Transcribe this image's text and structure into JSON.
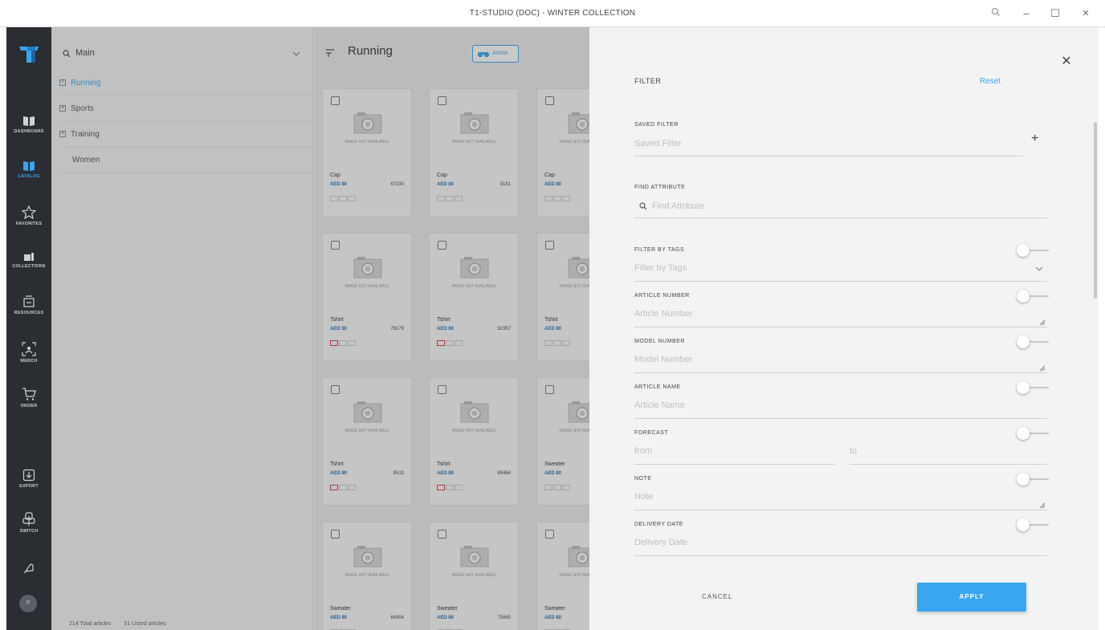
{
  "window": {
    "title": "T1-STUDIO (DOC) - WINTER COLLECTION"
  },
  "nav": [
    {
      "label": "DASHBOARD",
      "icon": "dashboard-icon"
    },
    {
      "label": "CATALOG",
      "icon": "catalog-icon"
    },
    {
      "label": "FAVORITES",
      "icon": "star-icon"
    },
    {
      "label": "COLLECTIONS",
      "icon": "collections-icon"
    },
    {
      "label": "RESOURCES",
      "icon": "resources-icon"
    },
    {
      "label": "MERCH",
      "icon": "merch-icon"
    },
    {
      "label": "ORDER",
      "icon": "cart-icon"
    },
    {
      "label": "EXPORT",
      "icon": "export-icon"
    },
    {
      "label": "SWITCH",
      "icon": "switch-icon"
    }
  ],
  "user": {
    "initials": "IT"
  },
  "tree": {
    "search_value": "Main",
    "items": [
      "Running",
      "Sports",
      "Training",
      "Women"
    ],
    "status": [
      "214 Total articles",
      "51 Listed articles"
    ]
  },
  "main": {
    "title": "Running",
    "article_button": "Article",
    "image_placeholder": "IMAGE NOT AVAILABLE",
    "price": "AED 80",
    "cards": [
      {
        "name": "Cap",
        "sku": "67330"
      },
      {
        "name": "Cap",
        "sku": "9181"
      },
      {
        "name": "Cap",
        "sku": ""
      },
      {
        "name": "Tshirt",
        "sku": "79179"
      },
      {
        "name": "Tshirt",
        "sku": "92357"
      },
      {
        "name": "Tshirt",
        "sku": ""
      },
      {
        "name": "Tshirt",
        "sku": "8519"
      },
      {
        "name": "Tshirt",
        "sku": "88464"
      },
      {
        "name": "Sweater",
        "sku": ""
      },
      {
        "name": "Sweater",
        "sku": "64904"
      },
      {
        "name": "Sweater",
        "sku": "75865"
      },
      {
        "name": "Sweater",
        "sku": ""
      }
    ]
  },
  "filter": {
    "title": "FILTER",
    "reset": "Reset",
    "saved_label": "SAVED FILTER",
    "saved_placeholder": "Saved Filter",
    "find_label": "FIND ATTRIBUTE",
    "find_placeholder": "Find Attribute",
    "fields": [
      {
        "label": "FILTER BY TAGS",
        "placeholder": "Filter by Tags"
      },
      {
        "label": "ARTICLE NUMBER",
        "placeholder": "Article Number"
      },
      {
        "label": "MODEL NUMBER",
        "placeholder": "Model Number"
      },
      {
        "label": "ARTICLE NAME",
        "placeholder": "Article Name"
      },
      {
        "label": "FORECAST",
        "placeholder": "from",
        "placeholder2": "to"
      },
      {
        "label": "NOTE",
        "placeholder": "Note"
      },
      {
        "label": "DELIVERY DATE",
        "placeholder": "Delivery Date"
      }
    ],
    "cancel": "CANCEL",
    "apply": "APPLY"
  },
  "colors": {
    "accent": "#3aa6f2",
    "rail": "#2a2d31"
  }
}
